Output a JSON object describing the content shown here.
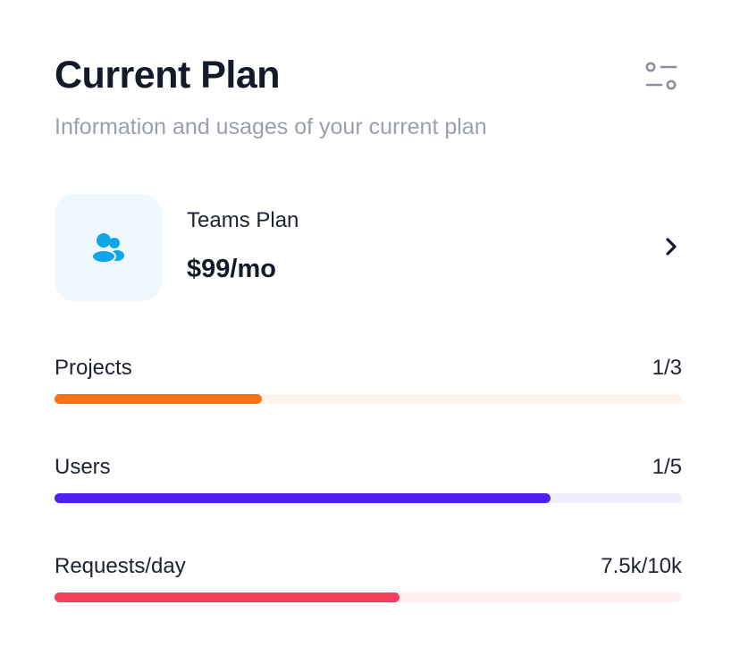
{
  "header": {
    "title": "Current Plan",
    "subtitle": "Information and usages of your current plan",
    "settings_icon": "sliders-icon"
  },
  "plan": {
    "icon": "users-icon",
    "name": "Teams Plan",
    "price": "$99/mo",
    "chevron_icon": "chevron-right-icon",
    "accent_color": "#0ea5e9"
  },
  "usage": [
    {
      "label": "Projects",
      "value": "1/3",
      "fraction": 0.33,
      "color": "#f97316",
      "track_color": "#fff4ec"
    },
    {
      "label": "Users",
      "value": "1/5",
      "fraction": 0.79,
      "color": "#4f1ff2",
      "track_color": "#efeefc"
    },
    {
      "label": "Requests/day",
      "value": "7.5k/10k",
      "fraction": 0.55,
      "color": "#f43f5e",
      "track_color": "#fff0f2"
    }
  ]
}
